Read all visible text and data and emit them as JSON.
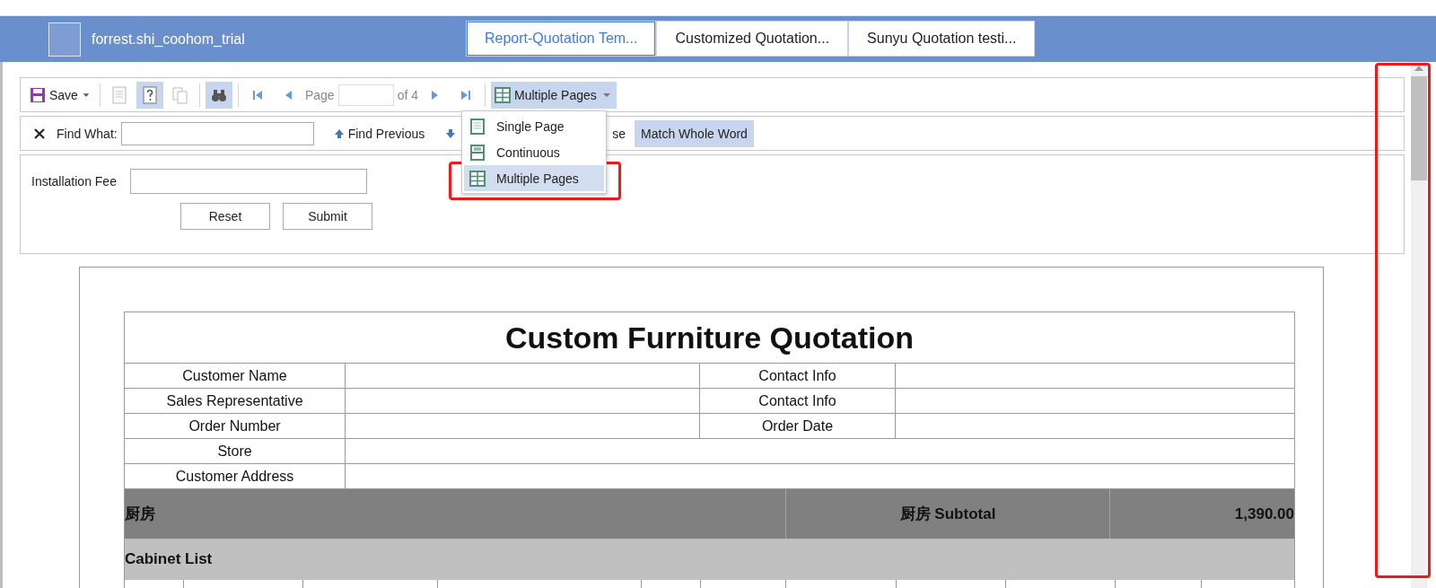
{
  "account": {
    "name": "forrest.shi_coohom_trial"
  },
  "report_tabs": [
    {
      "label": "Report-Quotation Tem...",
      "selected": true
    },
    {
      "label": "Customized Quotation...",
      "selected": false
    },
    {
      "label": "Sunyu Quotation testi...",
      "selected": false
    }
  ],
  "toolbar": {
    "save": "Save",
    "tools": [
      {
        "kind": "page",
        "selected": false
      },
      {
        "kind": "help",
        "selected": true
      },
      {
        "kind": "copy",
        "selected": false
      },
      {
        "kind": "find",
        "selected": true
      }
    ],
    "page_label": "Page",
    "page_count": "of 4",
    "view_button": {
      "label": "Multiple Pages",
      "expanded": true
    }
  },
  "view_menu": [
    {
      "kind": "single",
      "label": "Single Page",
      "selected": false
    },
    {
      "kind": "continuous",
      "label": "Continuous",
      "selected": false
    },
    {
      "kind": "multiple",
      "label": "Multiple Pages",
      "selected": true
    }
  ],
  "find_bar": {
    "label": "Find What:",
    "previous": "Find Previous",
    "match_case_tail": "se",
    "match_whole_word": {
      "label": "Match Whole Word",
      "selected": true
    }
  },
  "form": {
    "label": "Installation Fee",
    "buttons": [
      "Reset",
      "Submit"
    ]
  },
  "report": {
    "title": "Custom Furniture Quotation",
    "info_rows": [
      {
        "label": "Customer Name",
        "label_2": "Contact Info"
      },
      {
        "label": "Sales Representative",
        "label_2": "Contact Info"
      },
      {
        "label": "Order Number",
        "label_2": "Order Date"
      },
      {
        "label": "Store"
      },
      {
        "label": "Customer Address"
      }
    ],
    "section": {
      "name": "厨房",
      "subtotal_label": "厨房 Subtotal",
      "subtotal": "1,390.00"
    },
    "subsection": "Cabinet List"
  }
}
